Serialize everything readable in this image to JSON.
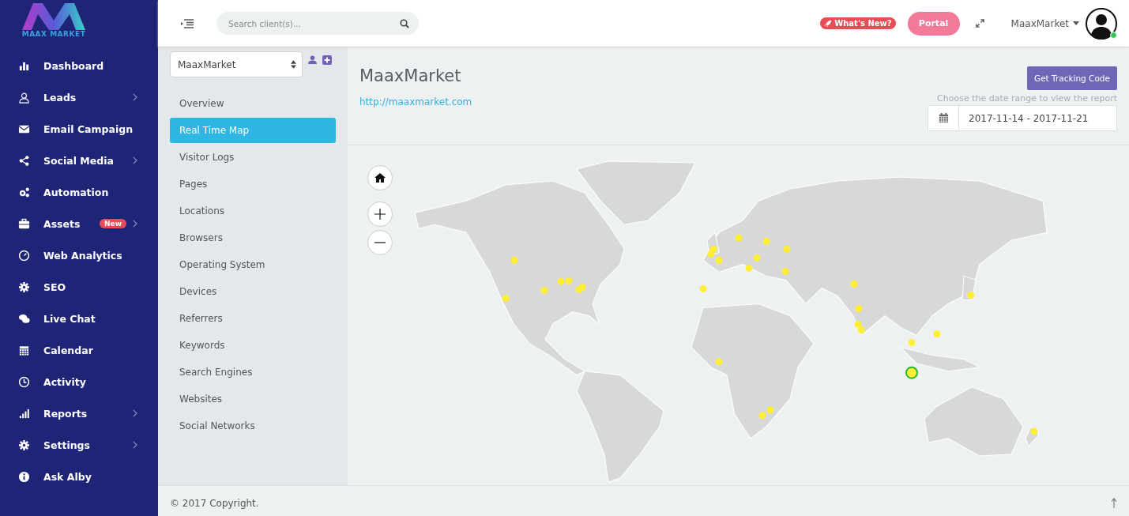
{
  "brand": {
    "logo_text": "MAAX MARKET"
  },
  "sidebar": {
    "items": [
      {
        "label": "Dashboard",
        "has_submenu": false
      },
      {
        "label": "Leads",
        "has_submenu": true
      },
      {
        "label": "Email Campaign",
        "has_submenu": false
      },
      {
        "label": "Social Media",
        "has_submenu": true
      },
      {
        "label": "Automation",
        "has_submenu": false
      },
      {
        "label": "Assets",
        "badge": "New",
        "has_submenu": true
      },
      {
        "label": "Web Analytics",
        "has_submenu": false
      },
      {
        "label": "SEO",
        "has_submenu": false
      },
      {
        "label": "Live Chat",
        "has_submenu": false
      },
      {
        "label": "Calendar",
        "has_submenu": false
      },
      {
        "label": "Activity",
        "has_submenu": false
      },
      {
        "label": "Reports",
        "has_submenu": true
      },
      {
        "label": "Settings",
        "has_submenu": true
      },
      {
        "label": "Ask Alby",
        "has_submenu": false
      }
    ]
  },
  "topbar": {
    "search": {
      "placeholder": "Search client(s)..."
    },
    "whats_new": "What's New?",
    "portal": "Portal",
    "user": "MaaxMarket",
    "online": true
  },
  "client_select": {
    "value": "MaaxMarket"
  },
  "subnav": [
    {
      "label": "Overview",
      "selected": false
    },
    {
      "label": "Real Time Map",
      "selected": true
    },
    {
      "label": "Visitor Logs",
      "selected": false
    },
    {
      "label": "Pages",
      "selected": false
    },
    {
      "label": "Locations",
      "selected": false
    },
    {
      "label": "Browsers",
      "selected": false
    },
    {
      "label": "Operating System",
      "selected": false
    },
    {
      "label": "Devices",
      "selected": false
    },
    {
      "label": "Referrers",
      "selected": false
    },
    {
      "label": "Keywords",
      "selected": false
    },
    {
      "label": "Search Engines",
      "selected": false
    },
    {
      "label": "Websites",
      "selected": false
    },
    {
      "label": "Social Networks",
      "selected": false
    }
  ],
  "site": {
    "title": "MaaxMarket",
    "url": "http://maaxmarket.com"
  },
  "tracking_button": "Get Tracking Code",
  "date_range": {
    "hint": "Choose the date range to view the report",
    "value": "2017-11-14 - 2017-11-21"
  },
  "footer": {
    "copyright": "© 2017 Copyright."
  }
}
